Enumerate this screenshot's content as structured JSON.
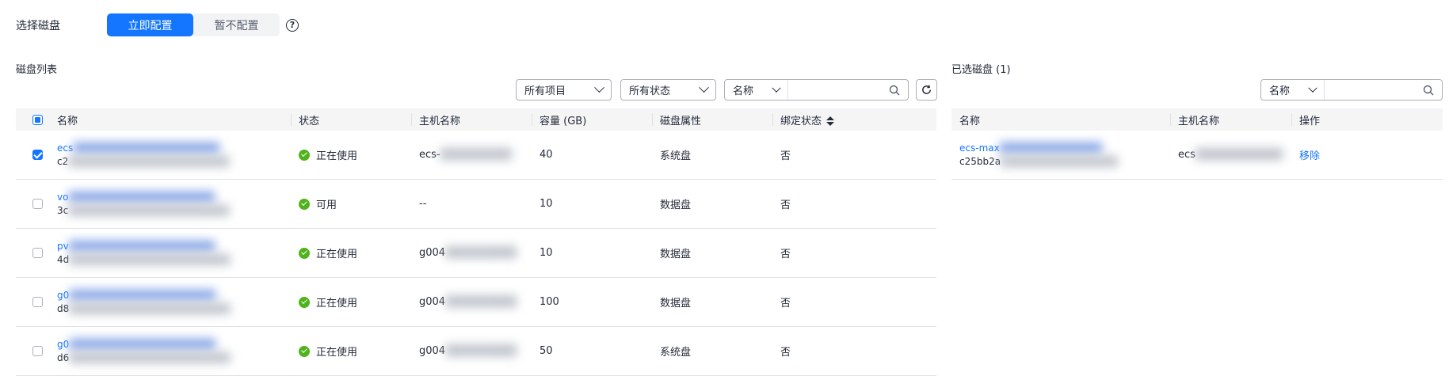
{
  "header": {
    "select_disk_label": "选择磁盘",
    "configure_now": "立即配置",
    "skip_configure": "暂不配置",
    "help": "?"
  },
  "disk_list": {
    "title": "磁盘列表",
    "filters": {
      "project": "所有项目",
      "status": "所有状态",
      "search_field": "名称",
      "search_placeholder": ""
    },
    "columns": [
      "名称",
      "状态",
      "主机名称",
      "容量 (GB)",
      "磁盘属性",
      "绑定状态"
    ],
    "rows": [
      {
        "checked": true,
        "name": "ecs",
        "id": "c2",
        "status": "正在使用",
        "host": "ecs-",
        "capacity": "40",
        "attr": "系统盘",
        "bound": "否"
      },
      {
        "checked": false,
        "name": "vo",
        "id": "3c",
        "status": "可用",
        "host": "--",
        "capacity": "10",
        "attr": "数据盘",
        "bound": "否"
      },
      {
        "checked": false,
        "name": "pv",
        "id": "4d",
        "status": "正在使用",
        "host": "g004",
        "capacity": "10",
        "attr": "数据盘",
        "bound": "否"
      },
      {
        "checked": false,
        "name": "g0",
        "id": "d8",
        "status": "正在使用",
        "host": "g004",
        "capacity": "100",
        "attr": "数据盘",
        "bound": "否"
      },
      {
        "checked": false,
        "name": "g0",
        "id": "d6",
        "status": "正在使用",
        "host": "g004",
        "capacity": "50",
        "attr": "系统盘",
        "bound": "否"
      }
    ]
  },
  "selected": {
    "title": "已选磁盘 (1)",
    "search_field": "名称",
    "columns": [
      "名称",
      "主机名称",
      "操作"
    ],
    "rows": [
      {
        "name": "ecs-max",
        "id": "c25bb2a",
        "host": "ecs",
        "action": "移除"
      }
    ]
  },
  "colors": {
    "primary": "#1476ff",
    "success": "#50b31c"
  }
}
